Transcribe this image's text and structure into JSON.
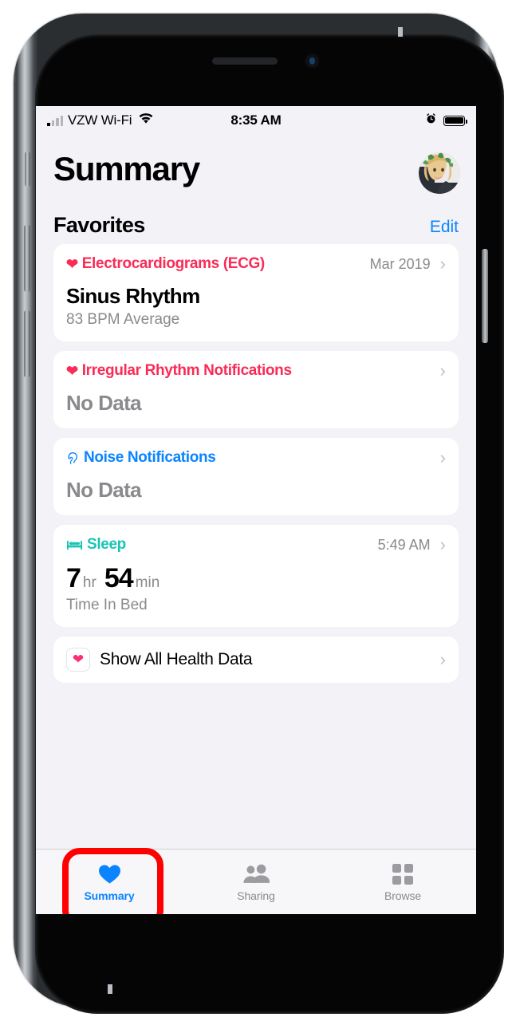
{
  "status_bar": {
    "carrier": "VZW Wi-Fi",
    "time": "8:35 AM",
    "signal_icon": "signal-bars-icon",
    "wifi_icon": "wifi-icon",
    "alarm_icon": "alarm-clock-icon",
    "battery_icon": "battery-icon"
  },
  "header": {
    "title": "Summary",
    "avatar_name": "profile-avatar"
  },
  "section": {
    "title": "Favorites",
    "edit_label": "Edit"
  },
  "cards": [
    {
      "icon": "heart-icon",
      "title": "Electrocardiograms (ECG)",
      "meta": "Mar 2019",
      "value": "Sinus Rhythm",
      "sub": "83 BPM Average",
      "color": "#fa2b56"
    },
    {
      "icon": "heart-icon",
      "title": "Irregular Rhythm Notifications",
      "meta": "",
      "value": "No Data",
      "sub": "",
      "color": "#fa2b56"
    },
    {
      "icon": "ear-icon",
      "title": "Noise Notifications",
      "meta": "",
      "value": "No Data",
      "sub": "",
      "color": "#0a84ff"
    },
    {
      "icon": "bed-icon",
      "title": "Sleep",
      "meta": "5:49 AM",
      "hours": "7",
      "hours_unit": "hr",
      "minutes": "54",
      "minutes_unit": "min",
      "sub": "Time In Bed",
      "color": "#18c5b4"
    }
  ],
  "show_all": {
    "label": "Show All Health Data",
    "icon": "health-app-icon",
    "chevron": "chevron-right-icon"
  },
  "tab_bar": {
    "tabs": [
      {
        "label": "Summary",
        "icon": "heart-icon",
        "active": true
      },
      {
        "label": "Sharing",
        "icon": "people-icon",
        "active": false
      },
      {
        "label": "Browse",
        "icon": "grid-icon",
        "active": false
      }
    ]
  },
  "annotation": {
    "shape": "rounded-rectangle",
    "color": "#ff0000",
    "target": "Summary"
  },
  "chevron_glyph": "›"
}
